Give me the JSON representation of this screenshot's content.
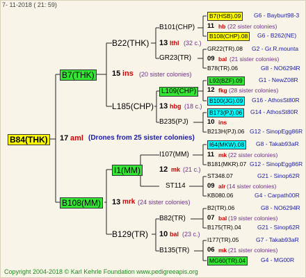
{
  "date": "7- 11-2018 ( 21: 59)",
  "root": {
    "name": "B84(THK)",
    "num": "17",
    "sp": "aml",
    "note": "(Drones from 25 sister colonies)"
  },
  "p": {
    "name": "B7(THK)",
    "num": "15",
    "sp": "ins",
    "note": "(20 sister colonies)"
  },
  "m": {
    "name": "B108(MM)",
    "num": "13",
    "sp": "mrk",
    "note": "(24 sister colonies)"
  },
  "pp": {
    "name": "B22(THK)",
    "num": "13",
    "sp": "lthl",
    "note": "(32 c.)"
  },
  "pm": {
    "name": "L185(CHP)",
    "num": "13",
    "sp": "hbg",
    "note": "(18 c.)"
  },
  "mp": {
    "name": "I1(MM)",
    "num": "12",
    "sp": "mk",
    "note": "(21 c.)"
  },
  "mm": {
    "name": "B129(TR)",
    "num": "10",
    "sp": "bal",
    "note": "(23 c.)"
  },
  "ppp": {
    "name": "B101(CHP)"
  },
  "ppm": {
    "name": "GR23(TR)"
  },
  "pmp": {
    "name": "L109(CHP)"
  },
  "pmm": {
    "name": "B235(PJ)"
  },
  "mpp": {
    "name": "I107(MM)"
  },
  "mpm": {
    "name": "ST114"
  },
  "mmp": {
    "name": "B82(TR)"
  },
  "mmm": {
    "name": "B135(TR)"
  },
  "g": [
    {
      "name": "B7(HSB).09",
      "note": "G6 - Bayburt98-3"
    },
    {
      "num": "11",
      "sp": "hb",
      "note": "(22 sister colonies)"
    },
    {
      "name": "B108(CHP).08",
      "note": "G6 - B262(NE)"
    },
    {
      "name": "GR22(TR).08",
      "note": "G2 - Gr.R.mounta"
    },
    {
      "num": "09",
      "sp": "bal",
      "note": "(21 sister colonies)"
    },
    {
      "name": "B78(TR).06",
      "note": "G8 - NO6294R"
    },
    {
      "name": "L92(BZF).09",
      "note": "G1 - NewZ08R"
    },
    {
      "num": "12",
      "sp": "fkg",
      "note": "(28 sister colonies)"
    },
    {
      "name": "B100(JG).09",
      "note": "G16 - AthosSt80R"
    },
    {
      "name": "B173(PJ).06",
      "note": "G14 - AthosSt80R"
    },
    {
      "num": "10",
      "sp": "ins",
      "note": ""
    },
    {
      "name": "B213H(PJ).06",
      "note": "G12 - SinopEgg86R"
    },
    {
      "name": "I64(MKW).08",
      "note": "G8 - Takab93aR"
    },
    {
      "num": "11",
      "sp": "mk",
      "note": "(22 sister colonies)"
    },
    {
      "name": "B181(MKR).07",
      "note": "G12 - SinopEgg86R"
    },
    {
      "name": "ST348.07",
      "note": "G21 - Sinop62R"
    },
    {
      "num": "09",
      "sp": "alr",
      "note": "(14 sister colonies)"
    },
    {
      "name": "KB080.06",
      "note": "G4 - Carpath00R"
    },
    {
      "name": "B2(TR).06",
      "note": "G8 - NO6294R"
    },
    {
      "num": "07",
      "sp": "bal",
      "note": "(19 sister colonies)"
    },
    {
      "name": "B175(TR).04",
      "note": "G21 - Sinop62R"
    },
    {
      "name": "I177(TR).05",
      "note": "G7 - Takab93aR"
    },
    {
      "num": "06",
      "sp": "mk",
      "note": "(21 sister colonies)"
    },
    {
      "name": "MG60(TR).04",
      "note": "G4 - MG00R"
    }
  ],
  "footer": "Copyright 2004-2018 © Karl Kehrle Foundation    www.pedigreeapis.org"
}
